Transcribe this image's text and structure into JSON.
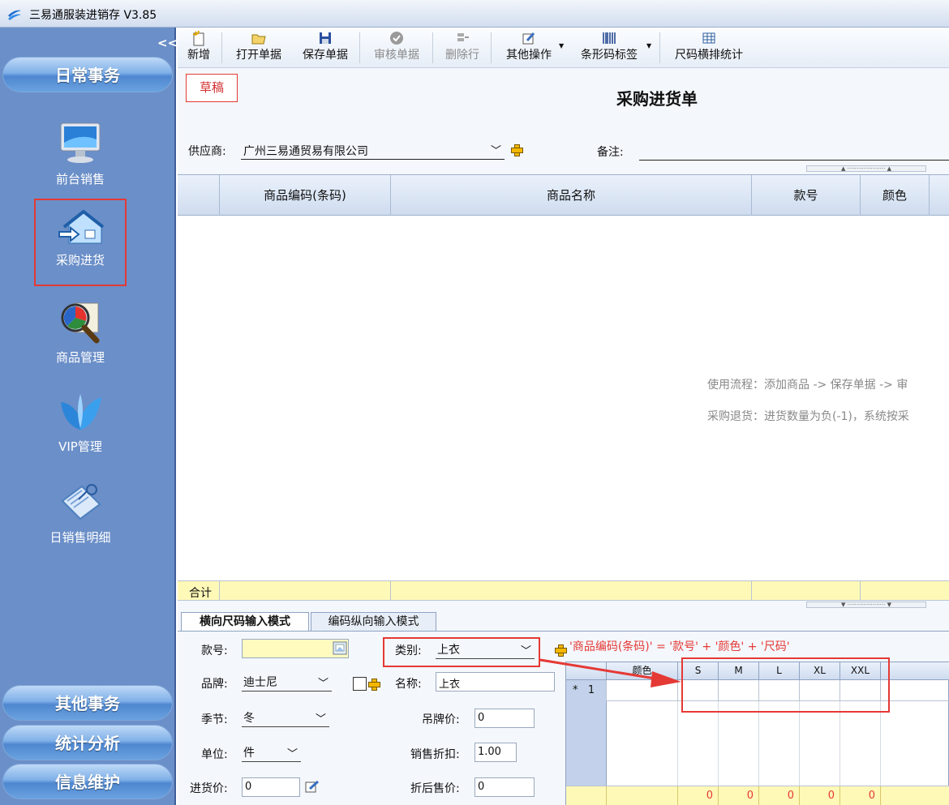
{
  "app": {
    "title": "三易通服装进销存 V3.85"
  },
  "sidebar": {
    "collapse_label": "<<",
    "sections": {
      "daily": "日常事务",
      "other": "其他事务",
      "stats": "统计分析",
      "info": "信息维护"
    },
    "items": [
      {
        "label": "前台销售",
        "icon": "monitor-icon"
      },
      {
        "label": "采购进货",
        "icon": "house-arrow-icon"
      },
      {
        "label": "商品管理",
        "icon": "magnifier-chart-icon"
      },
      {
        "label": "VIP管理",
        "icon": "butterfly-icon"
      },
      {
        "label": "日销售明细",
        "icon": "notebook-icon"
      }
    ],
    "selected": "采购进货"
  },
  "toolbar": {
    "new": "新增",
    "open": "打开单据",
    "save": "保存单据",
    "audit": "审核单据",
    "delete_row": "删除行",
    "other_ops": "其他操作",
    "barcode": "条形码标签",
    "size_stats": "尺码横排统计"
  },
  "document": {
    "status": "草稿",
    "title": "采购进货单",
    "supplier_label": "供应商:",
    "supplier_value": "广州三易通贸易有限公司",
    "remark_label": "备注:"
  },
  "grid": {
    "columns": [
      "商品编码(条码)",
      "商品名称",
      "款号",
      "颜色"
    ],
    "hint_flow": "使用流程：添加商品 -> 保存单据 -> 审",
    "hint_return": "采购退货：进货数量为负(-1)，系统按采",
    "total_label": "合计"
  },
  "entry": {
    "tabs": [
      "横向尺码输入模式",
      "编码纵向输入模式"
    ],
    "style_no_label": "款号:",
    "category_label": "类别:",
    "category_value": "上衣",
    "brand_label": "品牌:",
    "brand_value": "迪士尼",
    "name_label": "名称:",
    "name_value": "上衣",
    "season_label": "季节:",
    "season_value": "冬",
    "tag_price_label": "吊牌价:",
    "tag_price_value": "0",
    "unit_label": "单位:",
    "unit_value": "件",
    "discount_label": "销售折扣:",
    "discount_value": "1.00",
    "cost_label": "进货价:",
    "cost_value": "0",
    "after_price_label": "折后售价:",
    "after_price_value": "0",
    "formula": "'商品编码(条码)' = '款号' + '颜色' + '尺码'"
  },
  "size_grid": {
    "color_header": "颜色",
    "sizes": [
      "S",
      "M",
      "L",
      "XL",
      "XXL"
    ],
    "row_marker": "*",
    "row_number": "1",
    "totals": [
      "0",
      "0",
      "0",
      "0",
      "0"
    ]
  },
  "colors": {
    "sidebar": "#6b8fc8",
    "highlight": "#e53935",
    "total_row": "#fff9b8"
  }
}
